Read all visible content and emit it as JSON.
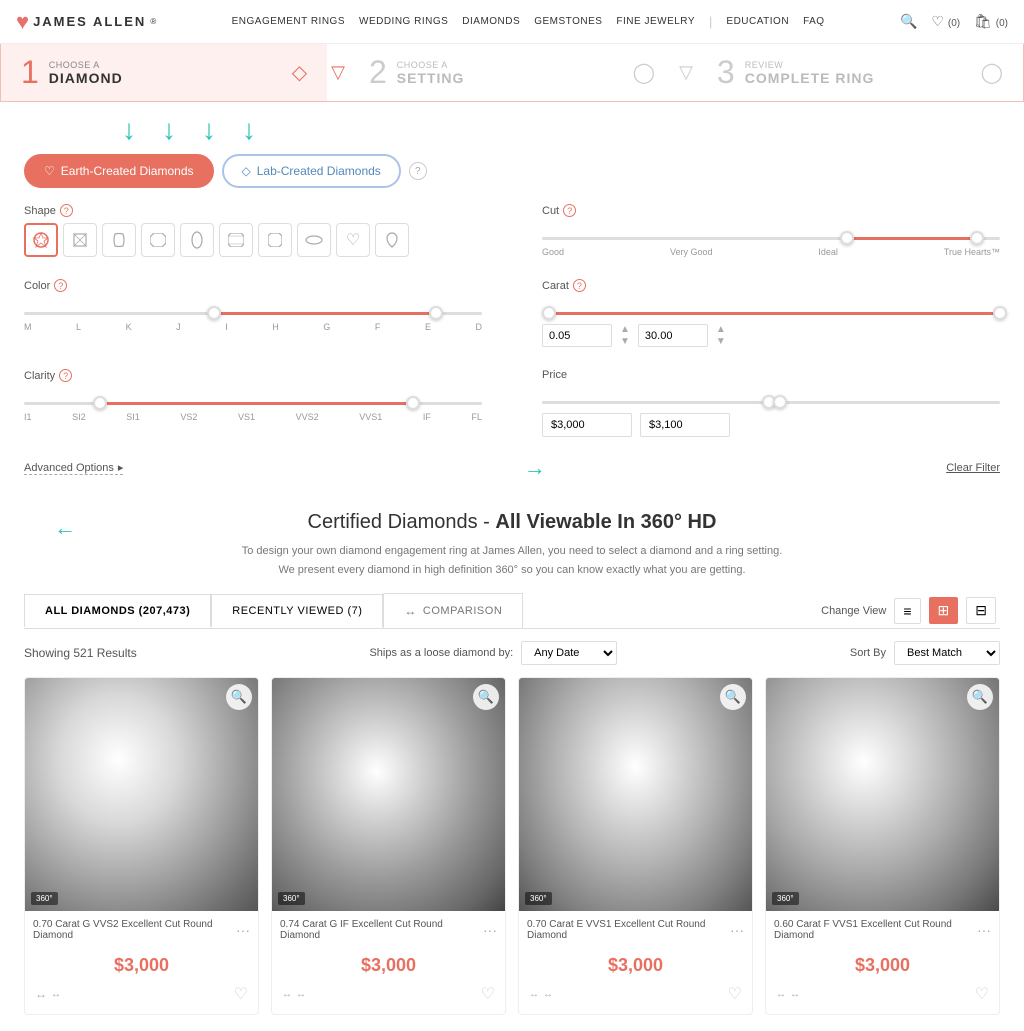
{
  "header": {
    "logo_text": "JAMES ALLEN",
    "logo_reg": "®",
    "nav_items": [
      "ENGAGEMENT RINGS",
      "WEDDING RINGS",
      "DIAMONDS",
      "GEMSTONES",
      "FINE JEWELRY",
      "EDUCATION",
      "FAQ"
    ],
    "wishlist_count": "(0)",
    "cart_count": "(0)"
  },
  "steps": [
    {
      "number": "1",
      "sub": "CHOOSE A",
      "main": "DIAMOND",
      "active": true
    },
    {
      "number": "2",
      "sub": "CHOOSE A",
      "main": "SETTING",
      "active": false
    },
    {
      "number": "3",
      "sub": "REVIEW",
      "main": "COMPLETE RING",
      "active": false
    }
  ],
  "filter_tabs": [
    {
      "label": "Earth-Created Diamonds",
      "active": true
    },
    {
      "label": "Lab-Created Diamonds",
      "active": false
    }
  ],
  "shape": {
    "label": "Shape",
    "shapes": [
      "◇",
      "◇",
      "◆",
      "▭",
      "◇",
      "◇",
      "▬",
      "◇",
      "♡",
      "◇"
    ],
    "selected": 0
  },
  "cut": {
    "label": "Cut",
    "labels": [
      "Good",
      "Very Good",
      "Ideal",
      "True Hearts™"
    ],
    "left_pct": 65,
    "right_pct": 95
  },
  "color": {
    "label": "Color",
    "labels": [
      "M",
      "L",
      "K",
      "J",
      "I",
      "H",
      "G",
      "F",
      "E",
      "D"
    ],
    "left_pct": 40,
    "right_pct": 90
  },
  "carat": {
    "label": "Carat",
    "min": "0.05",
    "max": "30.00"
  },
  "clarity": {
    "label": "Clarity",
    "labels": [
      "I1",
      "SI2",
      "SI1",
      "VS2",
      "VS1",
      "VVS2",
      "VVS1",
      "IF",
      "FL"
    ],
    "left_pct": 15,
    "right_pct": 85
  },
  "price": {
    "label": "Price",
    "min": "$3,000",
    "max": "$3,100"
  },
  "advanced": {
    "label": "Advanced Options",
    "arrow": "▸"
  },
  "clear_filter": "Clear Filter",
  "certified": {
    "title_plain": "Certified Diamonds - ",
    "title_bold": "All Viewable In 360° HD",
    "desc": "To design your own diamond engagement ring at James Allen, you need to select a diamond and a ring setting.\nWe present every diamond in high definition 360° so you can know exactly what you are getting."
  },
  "tabs": {
    "all_diamonds": "ALL DIAMONDS (207,473)",
    "recently_viewed": "RECENTLY VIEWED (7)",
    "comparison": "COMPARISON"
  },
  "results": {
    "showing": "Showing 521 Results",
    "ships_label": "Ships as a loose diamond by:",
    "ships_option": "Any Date",
    "sort_label": "Sort By",
    "sort_option": "Best Match"
  },
  "view_buttons": [
    "≡",
    "⊞",
    "⊟"
  ],
  "diamonds": [
    {
      "name": "0.70 Carat G VVS2 Excellent Cut Round Diamond",
      "price": "$3,000"
    },
    {
      "name": "0.74 Carat G IF Excellent Cut Round Diamond",
      "price": "$3,000"
    },
    {
      "name": "0.70 Carat E VVS1 Excellent Cut Round Diamond",
      "price": "$3,000"
    },
    {
      "name": "0.60 Carat F VVS1 Excellent Cut Round Diamond",
      "price": "$3,000"
    }
  ]
}
